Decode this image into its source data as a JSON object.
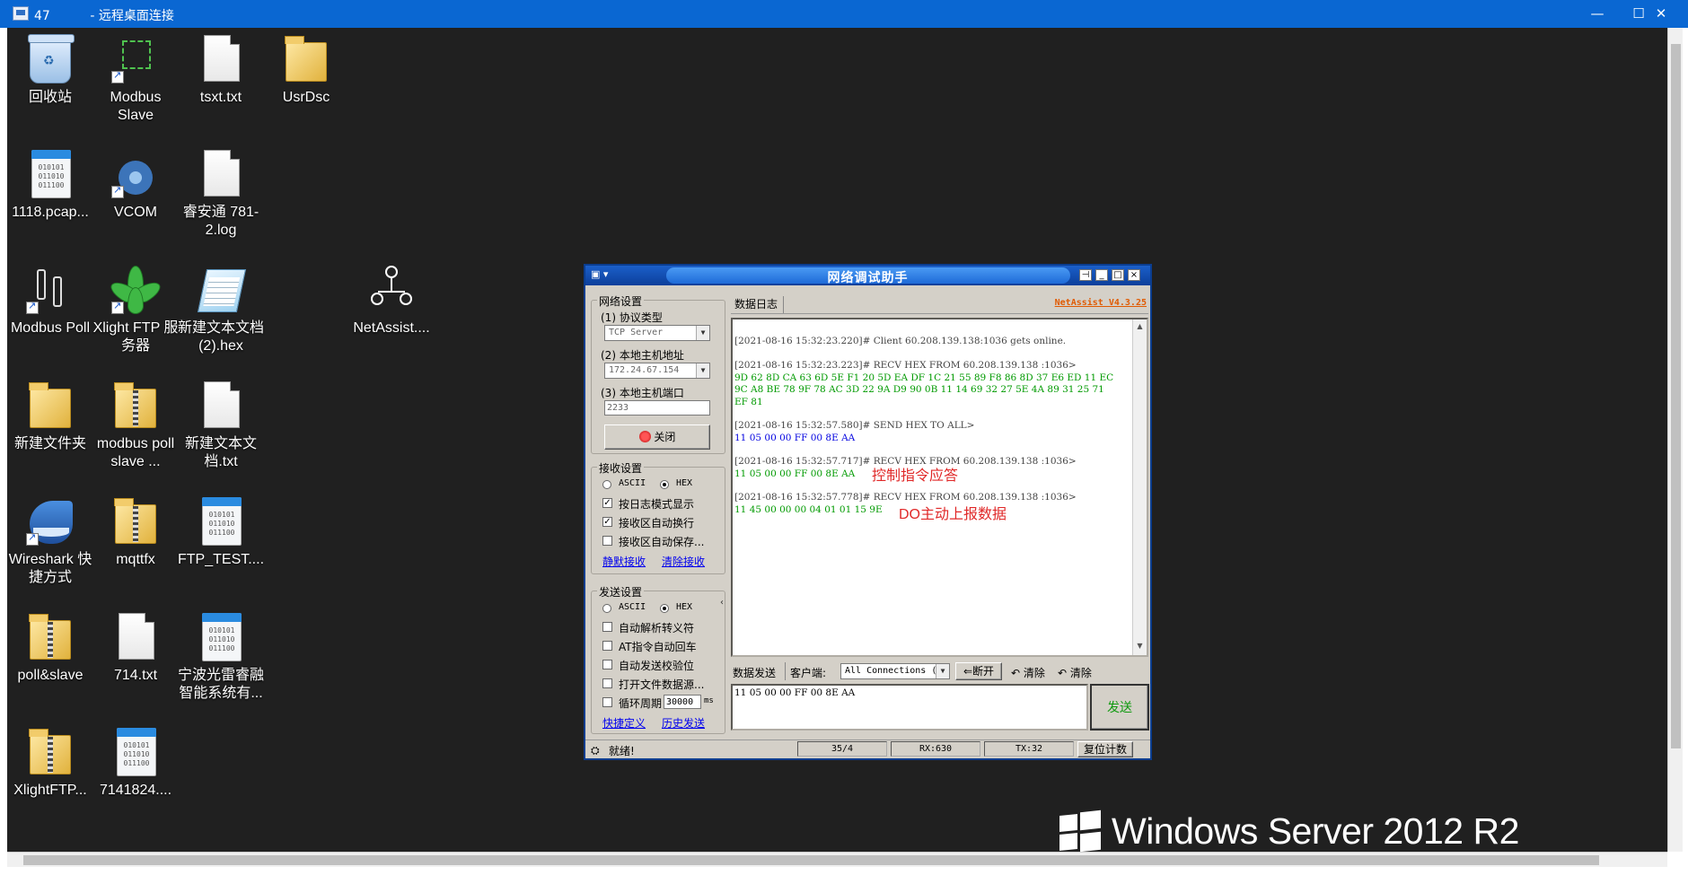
{
  "rdp": {
    "title": "47          - 远程桌面连接",
    "minimize": "—",
    "maximize": "☐",
    "close": "✕"
  },
  "desktop": {
    "icons": [
      {
        "label": "回收站",
        "icon": "recycle-bin-icon"
      },
      {
        "label": "Modbus Slave",
        "icon": "modbus-slave-icon"
      },
      {
        "label": "tsxt.txt",
        "icon": "text-file-icon"
      },
      {
        "label": "UsrDsc",
        "icon": "folder-icon"
      },
      {
        "label": "1118.pcap...",
        "icon": "binary-file-icon"
      },
      {
        "label": "VCOM",
        "icon": "vcom-icon"
      },
      {
        "label": "睿安通 781-2.log",
        "icon": "text-file-icon"
      },
      {
        "label": "Modbus Poll",
        "icon": "modbus-poll-icon"
      },
      {
        "label": "Xlight FTP 服务器",
        "icon": "xlight-icon"
      },
      {
        "label": "新建文本文档 (2).hex",
        "icon": "notepad-icon"
      },
      {
        "label": "NetAssist....",
        "icon": "netassist-icon"
      },
      {
        "label": "新建文件夹",
        "icon": "folder-icon"
      },
      {
        "label": "modbus poll slave ...",
        "icon": "zip-folder-icon"
      },
      {
        "label": "新建文本文 档.txt",
        "icon": "text-file-icon"
      },
      {
        "label": "Wireshark 快 捷方式",
        "icon": "wireshark-icon"
      },
      {
        "label": "mqttfx",
        "icon": "zip-folder-icon"
      },
      {
        "label": "FTP_TEST....",
        "icon": "binary-file-icon"
      },
      {
        "label": "poll&slave",
        "icon": "zip-folder-icon"
      },
      {
        "label": "714.txt",
        "icon": "text-file-icon"
      },
      {
        "label": "宁波光雷睿融 智能系统有...",
        "icon": "binary-file-icon"
      },
      {
        "label": "XlightFTP...",
        "icon": "zip-folder-icon"
      },
      {
        "label": "7141824....",
        "icon": "binary-file-icon"
      }
    ],
    "binary_pattern": [
      "010101",
      "011010",
      "011100"
    ],
    "os_brand": "Windows Server 2012 R2"
  },
  "netassist": {
    "title": "网络调试助手",
    "version": "NetAssist V4.3.25",
    "net_settings": {
      "group_label": "网络设置",
      "protocol_label": "(1) 协议类型",
      "protocol_value": "TCP Server",
      "host_ip_label": "(2) 本地主机地址",
      "host_ip_value": "172.24.67.154",
      "port_label": "(3) 本地主机端口",
      "port_value": "2233",
      "close_button": "关闭"
    },
    "recv_settings": {
      "group_label": "接收设置",
      "ascii": "ASCII",
      "hex": "HEX",
      "log_mode": "按日志模式显示",
      "auto_newline": "接收区自动换行",
      "auto_save": "接收区自动保存...",
      "save_data": "静默接收",
      "clear_recv": "清除接收"
    },
    "send_settings": {
      "group_label": "发送设置",
      "ascii": "ASCII",
      "hex": "HEX",
      "auto_escape": "自动解析转义符",
      "at_crlf": "AT指令自动回车",
      "auto_checksum": "自动发送校验位",
      "open_file": "打开文件数据源...",
      "loop_period": "循环周期",
      "loop_value": "30000",
      "loop_unit": "ms",
      "shortcut": "快捷定义",
      "history": "历史发送"
    },
    "log_tab": "数据日志",
    "log": [
      {
        "text": "[2021-08-16 15:32:23.220]# Client 60.208.139.138:1036 gets online.",
        "kind": "meta"
      },
      {
        "text": "[2021-08-16 15:32:23.223]# RECV HEX FROM 60.208.139.138 :1036>",
        "kind": "meta"
      },
      {
        "text": "9D 62 8D CA 63 6D 5E F1 20 5D EA DF 1C 21 55 89 F8 86 8D 37 E6 ED 11 EC",
        "kind": "green"
      },
      {
        "text": "9C A8 BE 78 9F 78 AC 3D 22 9A D9 90 0B 11 14 69 32 27 5E 4A 89 31 25 71",
        "kind": "green"
      },
      {
        "text": "EF 81",
        "kind": "green"
      },
      {
        "text": "[2021-08-16 15:32:57.580]# SEND HEX TO ALL>",
        "kind": "meta"
      },
      {
        "text": "11 05 00 00 FF 00 8E AA",
        "kind": "blue"
      },
      {
        "text": "[2021-08-16 15:32:57.717]# RECV HEX FROM 60.208.139.138 :1036>",
        "kind": "meta"
      },
      {
        "text": "11 05 00 00 FF 00 8E AA",
        "kind": "green"
      },
      {
        "text": "[2021-08-16 15:32:57.778]# RECV HEX FROM 60.208.139.138 :1036>",
        "kind": "meta"
      },
      {
        "text": "11 45 00 00 00 04 01 01 15 9E",
        "kind": "green"
      }
    ],
    "annotations": {
      "reply": "控制指令应答",
      "report": "DO主动上报数据"
    },
    "send_bar": {
      "data_send": "数据发送",
      "client_label": "客户端:",
      "client_value": "All Connections (1)",
      "disconnect": "断开",
      "clear1": "清除",
      "clear2": "清除"
    },
    "send_text": "11 05 00 00 FF 00 8E AA",
    "send_button": "发送",
    "status": {
      "ready": "就绪!",
      "counter": "35/4",
      "rx": "RX:630",
      "tx": "TX:32",
      "reset": "复位计数"
    }
  }
}
